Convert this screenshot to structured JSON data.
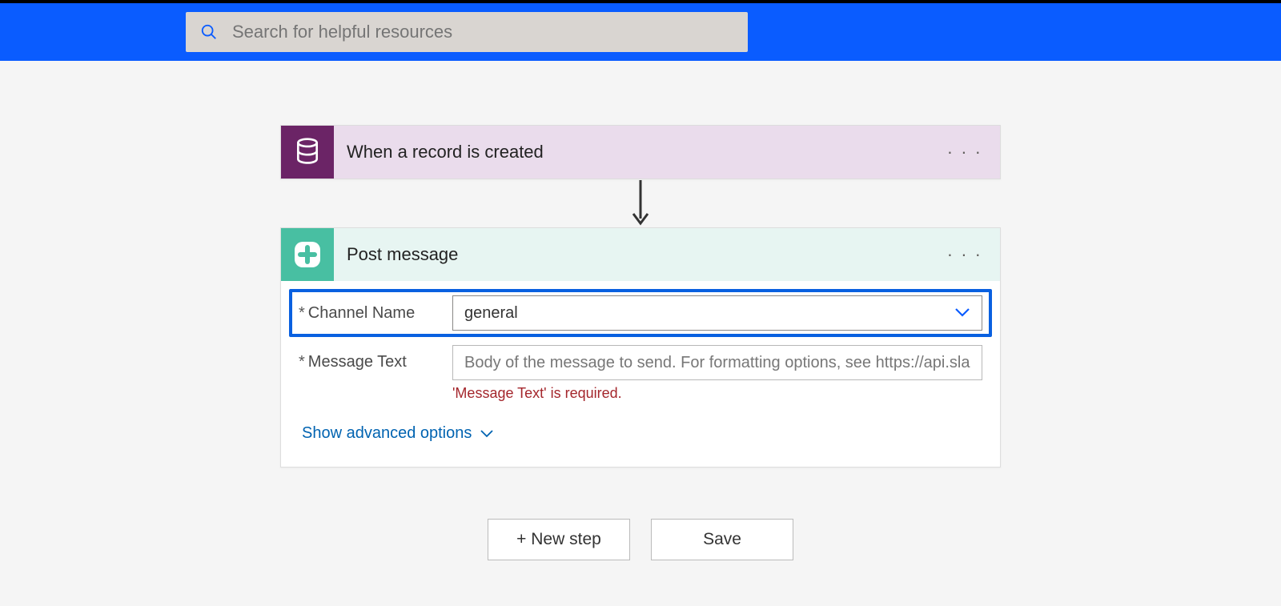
{
  "search": {
    "placeholder": "Search for helpful resources"
  },
  "trigger": {
    "title": "When a record is created"
  },
  "action": {
    "title": "Post message",
    "fields": {
      "channel": {
        "label": "Channel Name",
        "value": "general"
      },
      "message": {
        "label": "Message Text",
        "placeholder": "Body of the message to send. For formatting options, see https://api.slack.com/",
        "error": "'Message Text' is required."
      }
    },
    "advanced_label": "Show advanced options"
  },
  "buttons": {
    "new_step": "+ New step",
    "save": "Save"
  }
}
